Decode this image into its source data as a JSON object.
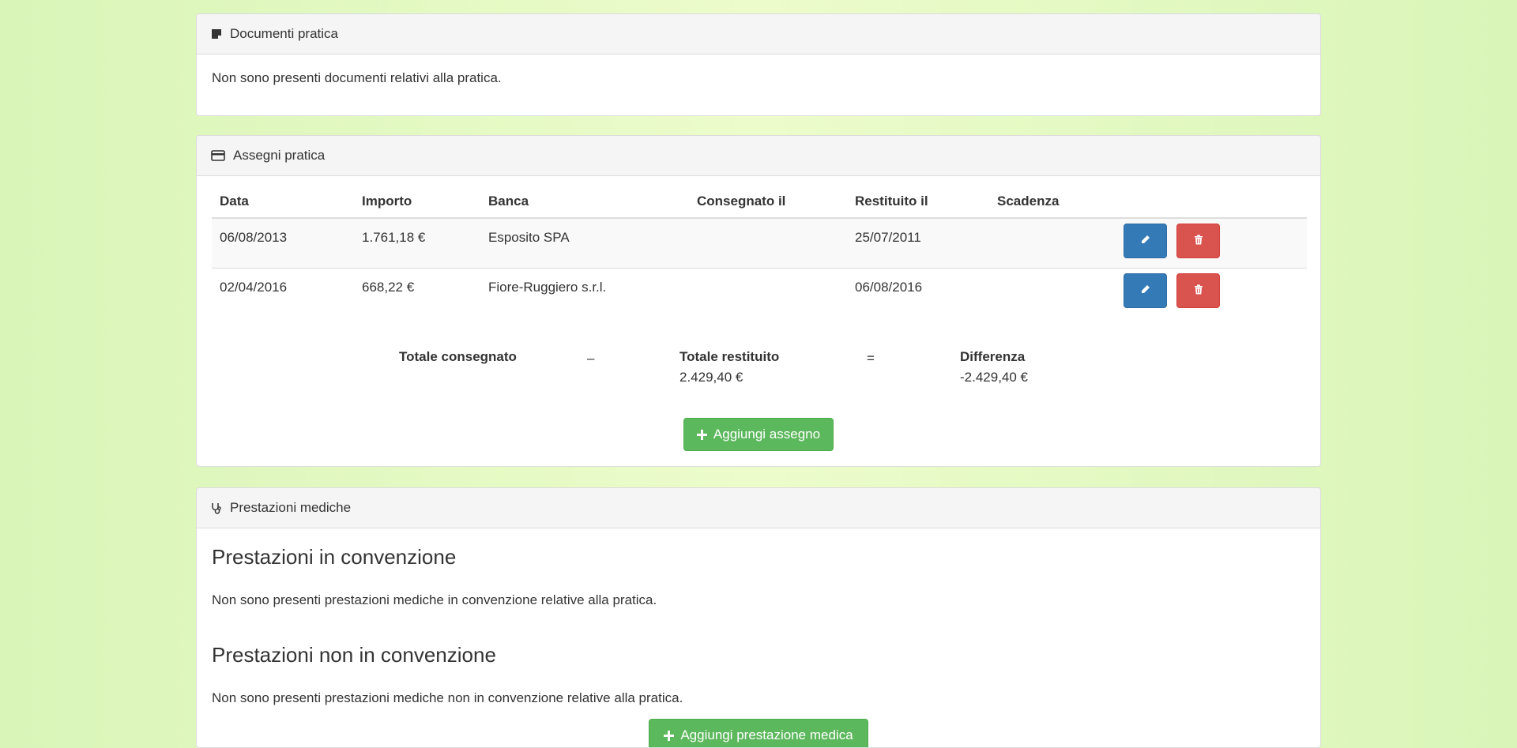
{
  "documents": {
    "title": "Documenti pratica",
    "empty_text": "Non sono presenti documenti relativi alla pratica."
  },
  "checks": {
    "title": "Assegni pratica",
    "columns": [
      "Data",
      "Importo",
      "Banca",
      "Consegnato il",
      "Restituito il",
      "Scadenza"
    ],
    "rows": [
      {
        "data": "06/08/2013",
        "importo": "1.761,18 €",
        "banca": "Esposito SPA",
        "consegnato": "",
        "restituito": "25/07/2011",
        "scadenza": ""
      },
      {
        "data": "02/04/2016",
        "importo": "668,22 €",
        "banca": "Fiore-Ruggiero s.r.l.",
        "consegnato": "",
        "restituito": "06/08/2016",
        "scadenza": ""
      }
    ],
    "totals": {
      "consegnato_label": "Totale consegnato",
      "consegnato_value": "",
      "minus": "–",
      "restituito_label": "Totale restituito",
      "restituito_value": "2.429,40 €",
      "equals": "=",
      "differenza_label": "Differenza",
      "differenza_value": "-2.429,40 €"
    },
    "add_button": "Aggiungi assegno",
    "colors": {
      "edit": "#337ab7",
      "delete": "#d9534f",
      "add": "#5cb85c"
    }
  },
  "prestazioni": {
    "title": "Prestazioni mediche",
    "conv_heading": "Prestazioni in convenzione",
    "conv_empty": "Non sono presenti prestazioni mediche in convenzione relative alla pratica.",
    "nonconv_heading": "Prestazioni non in convenzione",
    "nonconv_empty": "Non sono presenti prestazioni mediche non in convenzione relative alla pratica.",
    "add_button": "Aggiungi prestazione medica"
  },
  "icons": {
    "documents": "sticky-note-icon",
    "checks": "credit-card-icon",
    "prestazioni": "stethoscope-icon",
    "edit": "pencil-icon",
    "delete": "trash-icon",
    "add": "plus-icon"
  }
}
